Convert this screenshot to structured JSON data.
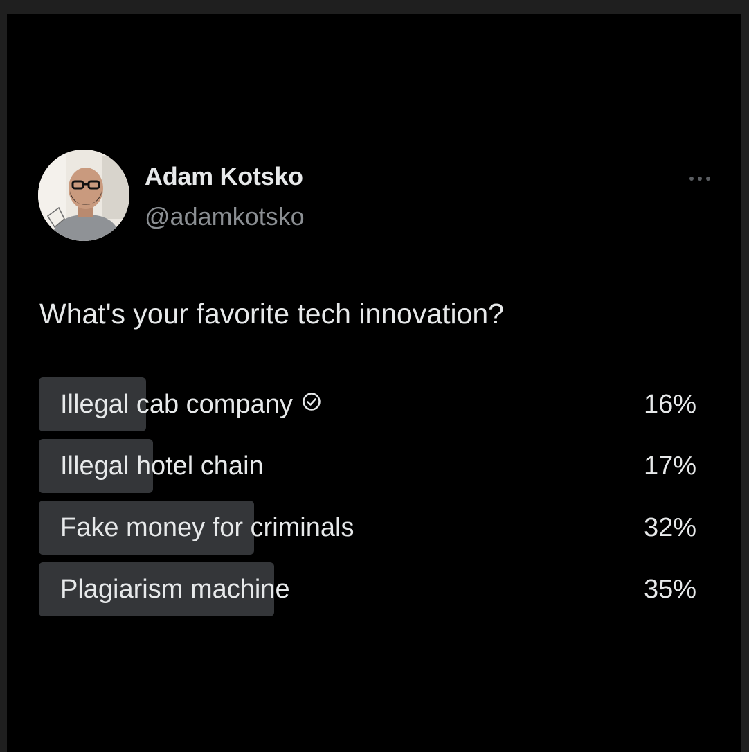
{
  "author": {
    "name": "Adam Kotsko",
    "handle": "@adamkotsko"
  },
  "tweet": {
    "text": "What's your favorite tech innovation?"
  },
  "poll": {
    "options": [
      {
        "label": "Illegal cab company",
        "percent": 16,
        "percent_label": "16%",
        "selected": true
      },
      {
        "label": "Illegal hotel chain",
        "percent": 17,
        "percent_label": "17%",
        "selected": false
      },
      {
        "label": "Fake money for criminals",
        "percent": 32,
        "percent_label": "32%",
        "selected": false
      },
      {
        "label": "Plagiarism machine",
        "percent": 35,
        "percent_label": "35%",
        "selected": false
      }
    ],
    "bar_color": "#343639"
  },
  "colors": {
    "background": "#000000",
    "text": "#e7e9ea",
    "secondary_text": "#8b8f93"
  },
  "icons": {
    "more": "more-dots-icon",
    "vote": "check-circle-icon"
  }
}
